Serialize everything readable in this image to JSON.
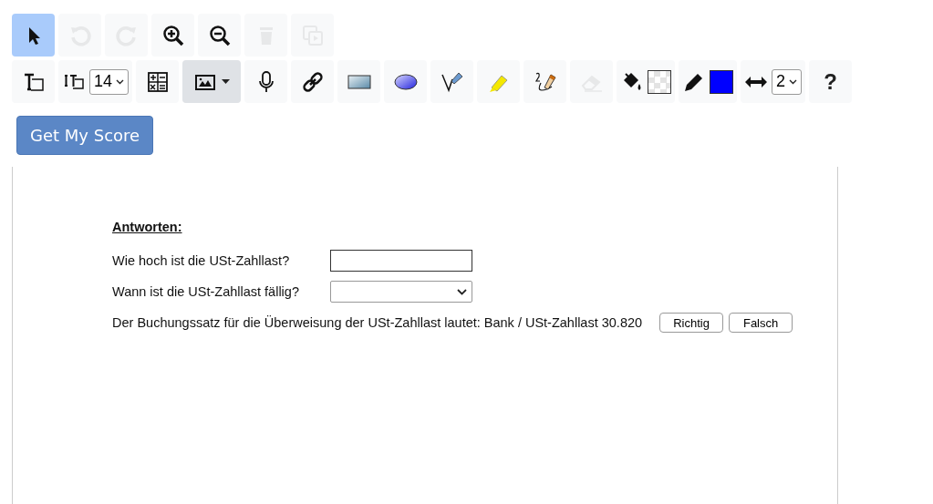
{
  "toolbar_rows": [
    [
      {
        "kind": "select",
        "selected": true,
        "disabled": false,
        "highlighted": false
      },
      {
        "kind": "undo",
        "selected": false,
        "disabled": true,
        "highlighted": false
      },
      {
        "kind": "redo",
        "selected": false,
        "disabled": true,
        "highlighted": false
      },
      {
        "kind": "zoom-in",
        "selected": false,
        "disabled": false,
        "highlighted": false
      },
      {
        "kind": "zoom-out",
        "selected": false,
        "disabled": false,
        "highlighted": false
      },
      {
        "kind": "delete",
        "selected": false,
        "disabled": true,
        "highlighted": false
      },
      {
        "kind": "duplicate",
        "selected": false,
        "disabled": true,
        "highlighted": false
      }
    ],
    [
      {
        "kind": "text",
        "selected": false,
        "disabled": false,
        "highlighted": false
      },
      {
        "kind": "text-size",
        "selected": false,
        "disabled": false,
        "highlighted": false,
        "value": "14"
      },
      {
        "kind": "math",
        "selected": false,
        "disabled": false,
        "highlighted": false
      },
      {
        "kind": "image",
        "selected": false,
        "disabled": false,
        "highlighted": true
      },
      {
        "kind": "microphone",
        "selected": false,
        "disabled": false,
        "highlighted": false
      },
      {
        "kind": "link",
        "selected": false,
        "disabled": false,
        "highlighted": false
      },
      {
        "kind": "rectangle",
        "selected": false,
        "disabled": false,
        "highlighted": false
      },
      {
        "kind": "ellipse",
        "selected": false,
        "disabled": false,
        "highlighted": false
      },
      {
        "kind": "pen",
        "selected": false,
        "disabled": false,
        "highlighted": false
      },
      {
        "kind": "highlighter",
        "selected": false,
        "disabled": false,
        "highlighted": false
      },
      {
        "kind": "handwriting",
        "selected": false,
        "disabled": false,
        "highlighted": false
      },
      {
        "kind": "eraser",
        "selected": false,
        "disabled": true,
        "highlighted": false
      },
      {
        "kind": "fill",
        "selected": false,
        "disabled": false,
        "highlighted": false
      },
      {
        "kind": "stroke",
        "selected": false,
        "disabled": false,
        "highlighted": false,
        "color": "#0000ff"
      },
      {
        "kind": "line-width",
        "selected": false,
        "disabled": false,
        "highlighted": false,
        "value": "2"
      },
      {
        "kind": "help",
        "selected": false,
        "disabled": false,
        "highlighted": false,
        "label": "?"
      }
    ]
  ],
  "score_button": "Get My Score",
  "answers": {
    "heading": "Antworten:",
    "items": [
      {
        "kind": "input",
        "label": "Wie hoch ist die USt-Zahllast?"
      },
      {
        "kind": "select",
        "label": "Wann ist die USt-Zahllast fällig?"
      },
      {
        "kind": "truefalse",
        "label": "Der Buchungssatz für die Überweisung der USt-Zahllast lautet: Bank / USt-Zahllast 30.820",
        "buttons": [
          "Richtig",
          "Falsch"
        ]
      }
    ]
  }
}
